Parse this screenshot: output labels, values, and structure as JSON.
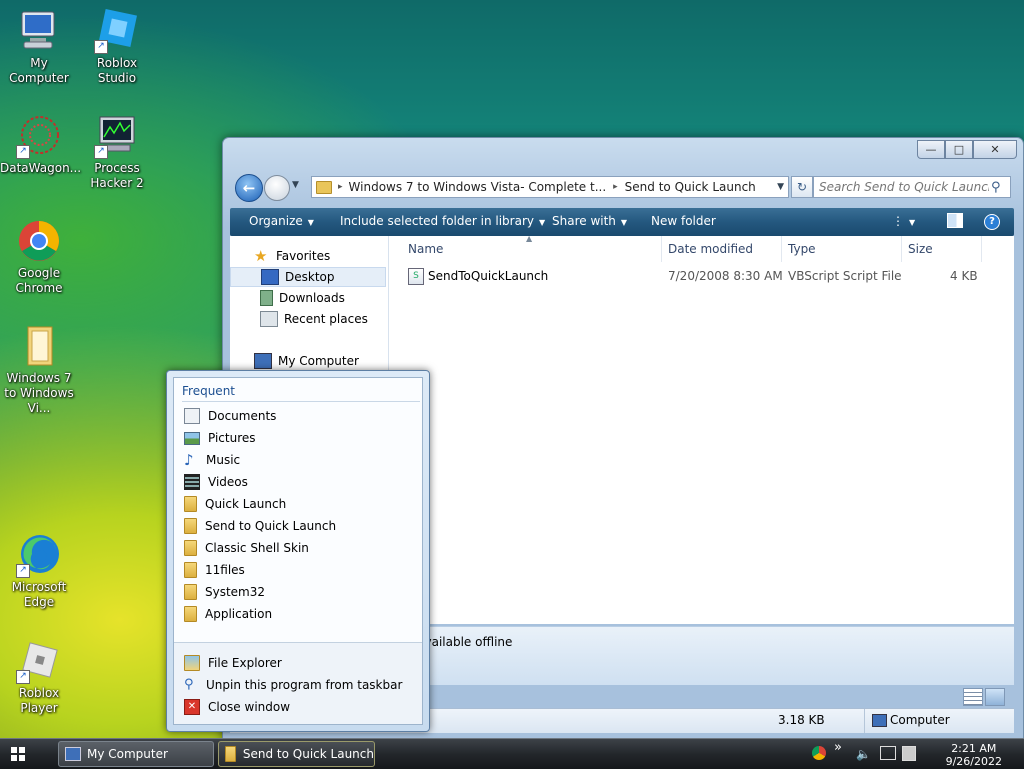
{
  "desktop": {
    "icons": [
      {
        "label": "My Computer"
      },
      {
        "label": "Roblox Studio"
      },
      {
        "label": "DataWagon..."
      },
      {
        "label": "Process Hacker 2"
      },
      {
        "label": "Google Chrome"
      },
      {
        "label": "Windows 7 to Windows Vi..."
      },
      {
        "label": "Microsoft Edge"
      },
      {
        "label": "Roblox Player"
      }
    ]
  },
  "explorer": {
    "caption_buttons": {
      "minimize": "—",
      "maximize": "□",
      "close": "✕"
    },
    "address": {
      "segment1": "Windows 7 to Windows Vista- Complete t...",
      "separator": "▸",
      "segment2": "Send to Quick Launch"
    },
    "search": {
      "placeholder": "Search Send to Quick Launch"
    },
    "toolbar": {
      "organize": "Organize",
      "include": "Include selected folder in library",
      "share": "Share with",
      "new_folder": "New folder"
    },
    "nav": {
      "favorites": "Favorites",
      "desktop": "Desktop",
      "downloads": "Downloads",
      "recent": "Recent places",
      "computer": "My Computer"
    },
    "columns": {
      "name": "Name",
      "date": "Date modified",
      "type": "Type",
      "size": "Size"
    },
    "files": [
      {
        "name": "SendToQuickLaunch",
        "date": "7/20/2008 8:30 AM",
        "type": "VBScript Script File",
        "size": "4 KB"
      }
    ],
    "details": {
      "offline": "Available offline"
    },
    "status": {
      "size": "3.18 KB",
      "location": "Computer"
    }
  },
  "jumplist": {
    "header": "Frequent",
    "items": [
      {
        "label": "Documents",
        "icon": "documents-icon"
      },
      {
        "label": "Pictures",
        "icon": "pictures-icon"
      },
      {
        "label": "Music",
        "icon": "music-icon"
      },
      {
        "label": "Videos",
        "icon": "videos-icon"
      },
      {
        "label": "Quick Launch",
        "icon": "folder-icon"
      },
      {
        "label": "Send to Quick Launch",
        "icon": "folder-icon"
      },
      {
        "label": "Classic Shell Skin",
        "icon": "folder-icon"
      },
      {
        "label": "11files",
        "icon": "folder-icon"
      },
      {
        "label": "System32",
        "icon": "folder-icon"
      },
      {
        "label": "Application",
        "icon": "folder-icon"
      }
    ],
    "tasks": [
      {
        "label": "File Explorer",
        "icon": "file-explorer-icon"
      },
      {
        "label": "Unpin this program from taskbar",
        "icon": "pin-icon"
      },
      {
        "label": "Close window",
        "icon": "close-window-icon"
      }
    ]
  },
  "taskbar": {
    "buttons": [
      {
        "label": "My Computer"
      },
      {
        "label": "Send to Quick Launch"
      }
    ],
    "overflow": "»",
    "clock": {
      "time": "2:21 AM",
      "date": "9/26/2022"
    }
  }
}
